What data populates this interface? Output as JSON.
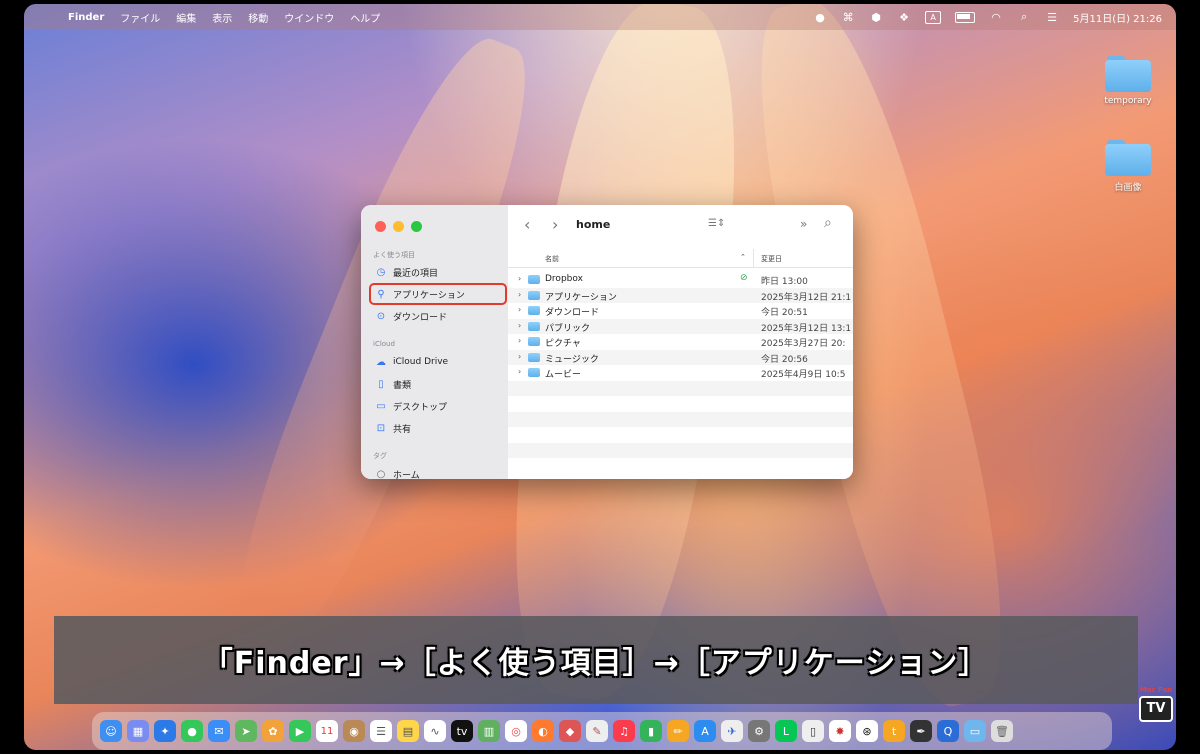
{
  "menubar": {
    "apple_icon": "",
    "app_name": "Finder",
    "menus": [
      "ファイル",
      "編集",
      "表示",
      "移動",
      "ウインドウ",
      "ヘルプ"
    ],
    "input_indicator": "A",
    "datetime": "5月11日(日) 21:26"
  },
  "desktop": {
    "items": [
      {
        "label": "temporary"
      },
      {
        "label": "白画像"
      }
    ]
  },
  "finder": {
    "title": "home",
    "sidebar": {
      "favorites_header": "よく使う項目",
      "favorites": [
        {
          "label": "最近の項目",
          "icon": "clock-icon"
        },
        {
          "label": "アプリケーション",
          "icon": "applications-icon"
        },
        {
          "label": "ダウンロード",
          "icon": "download-icon"
        }
      ],
      "icloud_header": "iCloud",
      "icloud": [
        {
          "label": "iCloud Drive",
          "icon": "cloud-icon"
        },
        {
          "label": "書類",
          "icon": "document-icon"
        },
        {
          "label": "デスクトップ",
          "icon": "desktop-icon"
        },
        {
          "label": "共有",
          "icon": "shared-folder-icon"
        }
      ],
      "tags_header": "タグ",
      "tags": [
        {
          "label": "ホーム",
          "icon": "tag-icon"
        }
      ]
    },
    "columns": {
      "name": "名前",
      "modified": "変更日"
    },
    "rows": [
      {
        "name": "Dropbox",
        "date": "昨日 13:00"
      },
      {
        "name": "アプリケーション",
        "date": "2025年3月12日 21:1"
      },
      {
        "name": "ダウンロード",
        "date": "今日 20:51"
      },
      {
        "name": "パブリック",
        "date": "2025年3月12日 13:1"
      },
      {
        "name": "ピクチャ",
        "date": "2025年3月27日 20:"
      },
      {
        "name": "ミュージック",
        "date": "今日 20:56"
      },
      {
        "name": "ムービー",
        "date": "2025年4月9日 10:5"
      }
    ]
  },
  "caption": "「Finder」→［よく使う項目］→［アプリケーション］",
  "logo": {
    "small": "Mac Fan",
    "big": "TV"
  },
  "dock_calendar_day": "11"
}
